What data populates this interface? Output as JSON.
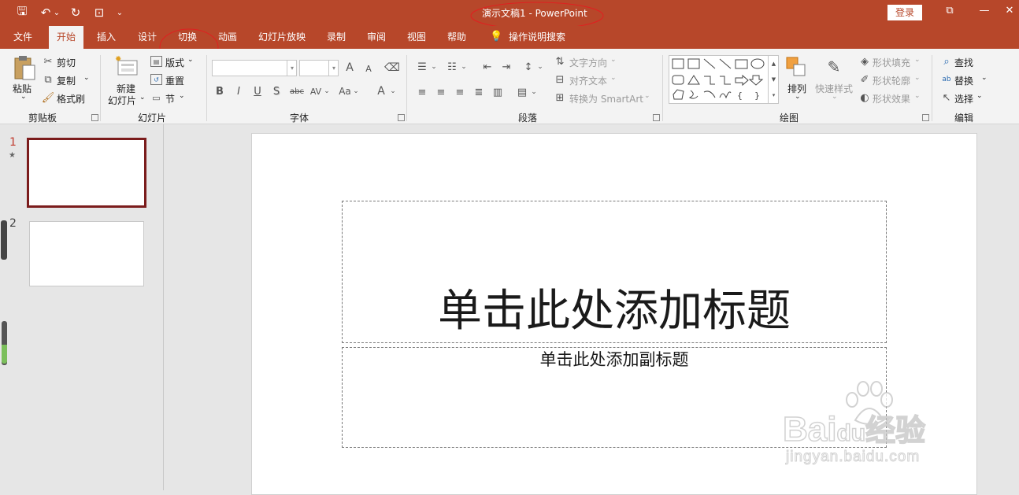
{
  "window": {
    "title": "演示文稿1  -  PowerPoint",
    "signin": "登录",
    "controls": [
      "⧉",
      "—",
      "✕"
    ]
  },
  "qat": {
    "save": "🖫",
    "undo": "↶",
    "undo_drop": "⌄",
    "redo": "↻",
    "present": "⊡",
    "customize": "⌄"
  },
  "tabs": [
    {
      "label": "文件",
      "active": false
    },
    {
      "label": "开始",
      "active": true
    },
    {
      "label": "插入",
      "active": false
    },
    {
      "label": "设计",
      "active": false
    },
    {
      "label": "切换",
      "active": false
    },
    {
      "label": "动画",
      "active": false
    },
    {
      "label": "幻灯片放映",
      "active": false
    },
    {
      "label": "录制",
      "active": false
    },
    {
      "label": "审阅",
      "active": false
    },
    {
      "label": "视图",
      "active": false
    },
    {
      "label": "帮助",
      "active": false
    }
  ],
  "tell_me": "操作说明搜索",
  "ribbon": {
    "clipboard": {
      "paste": "粘贴",
      "cut": "剪切",
      "copy": "复制",
      "format_painter": "格式刷",
      "group": "剪贴板"
    },
    "slides": {
      "new_slide_1": "新建",
      "new_slide_2": "幻灯片",
      "layout": "版式",
      "reset": "重置",
      "section": "节",
      "group": "幻灯片"
    },
    "font": {
      "group": "字体",
      "bold": "B",
      "italic": "I",
      "underline": "U",
      "shadow": "S",
      "strike": "abc",
      "spacing": "AV",
      "case": "Aa",
      "color": "A",
      "grow": "A",
      "shrink": "A"
    },
    "paragraph": {
      "group": "段落",
      "text_direction": "文字方向",
      "align_text": "对齐文本",
      "smartart": "转换为 SmartArt"
    },
    "drawing": {
      "group": "绘图",
      "arrange": "排列",
      "quick_styles": "快速样式",
      "shape_fill": "形状填充",
      "shape_outline": "形状轮廓",
      "shape_effects": "形状效果"
    },
    "editing": {
      "group": "编辑",
      "find": "查找",
      "replace": "替换",
      "select": "选择"
    }
  },
  "thumbnails": [
    {
      "number": "1",
      "star": "★"
    },
    {
      "number": "2"
    }
  ],
  "slide": {
    "title_placeholder": "单击此处添加标题",
    "subtitle_placeholder": "单击此处添加副标题"
  },
  "watermark": {
    "brand_1": "Bai",
    "brand_2": "du",
    "brand_3": "经验",
    "url": "jingyan.baidu.com"
  },
  "colors": {
    "accent": "#b7472a",
    "selected_thumb": "#7b1c1c"
  }
}
